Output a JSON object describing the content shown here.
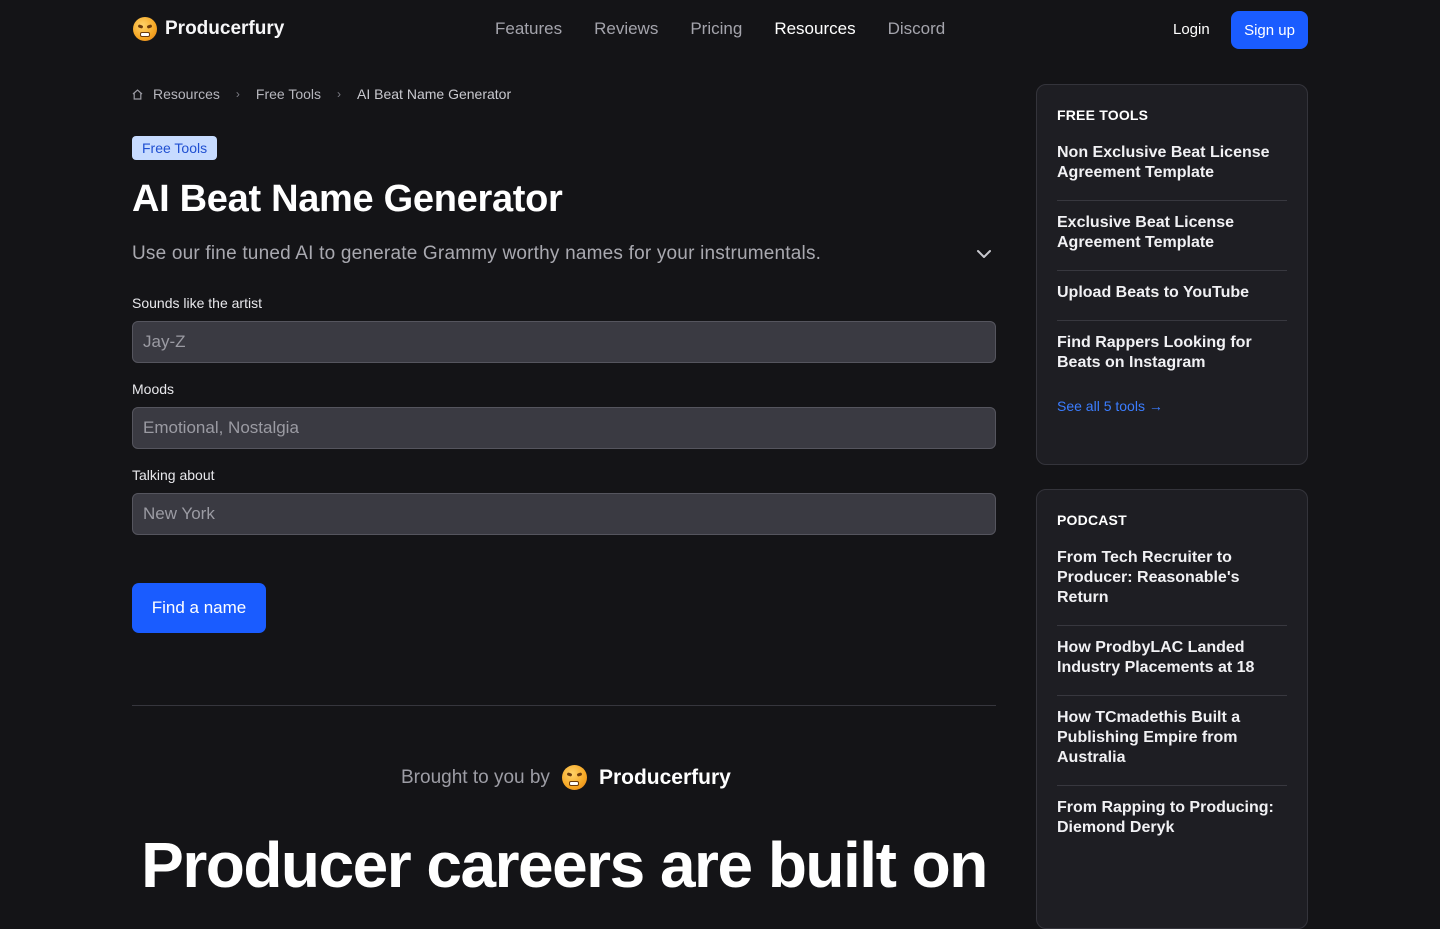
{
  "nav": {
    "brand": "Producerfury",
    "links": [
      "Features",
      "Reviews",
      "Pricing",
      "Resources",
      "Discord"
    ],
    "active_link": "Resources",
    "login": "Login",
    "signup": "Sign up"
  },
  "breadcrumb": [
    "Resources",
    "Free Tools",
    "AI Beat Name Generator"
  ],
  "badge": "Free Tools",
  "title": "AI Beat Name Generator",
  "subtitle": "Use our fine tuned AI to generate Grammy worthy names for your instrumentals.",
  "form": {
    "fields": [
      {
        "label": "Sounds like the artist",
        "placeholder": "Jay-Z"
      },
      {
        "label": "Moods",
        "placeholder": "Emotional, Nostalgia"
      },
      {
        "label": "Talking about",
        "placeholder": "New York"
      }
    ],
    "submit": "Find a name"
  },
  "brought_by": {
    "text": "Brought to you by",
    "brand": "Producerfury"
  },
  "hero": "Producer careers are built on",
  "sidebar": {
    "free_tools": {
      "heading": "FREE TOOLS",
      "items": [
        "Non Exclusive Beat License Agreement Template",
        "Exclusive Beat License Agreement Template",
        "Upload Beats to YouTube",
        "Find Rappers Looking for Beats on Instagram"
      ],
      "see_all": "See all 5 tools →"
    },
    "podcast": {
      "heading": "PODCAST",
      "items": [
        "From Tech Recruiter to Producer: Reasonable's Return",
        "How ProdbyLAC Landed Industry Placements at 18",
        "How TCmadethis Built a Publishing Empire from Australia",
        "From Rapping to Producing: Diemond Deryk"
      ]
    }
  },
  "colors": {
    "accent": "#1a5cff",
    "background": "#141417",
    "card": "#1e1e23",
    "link": "#3b7dff"
  }
}
